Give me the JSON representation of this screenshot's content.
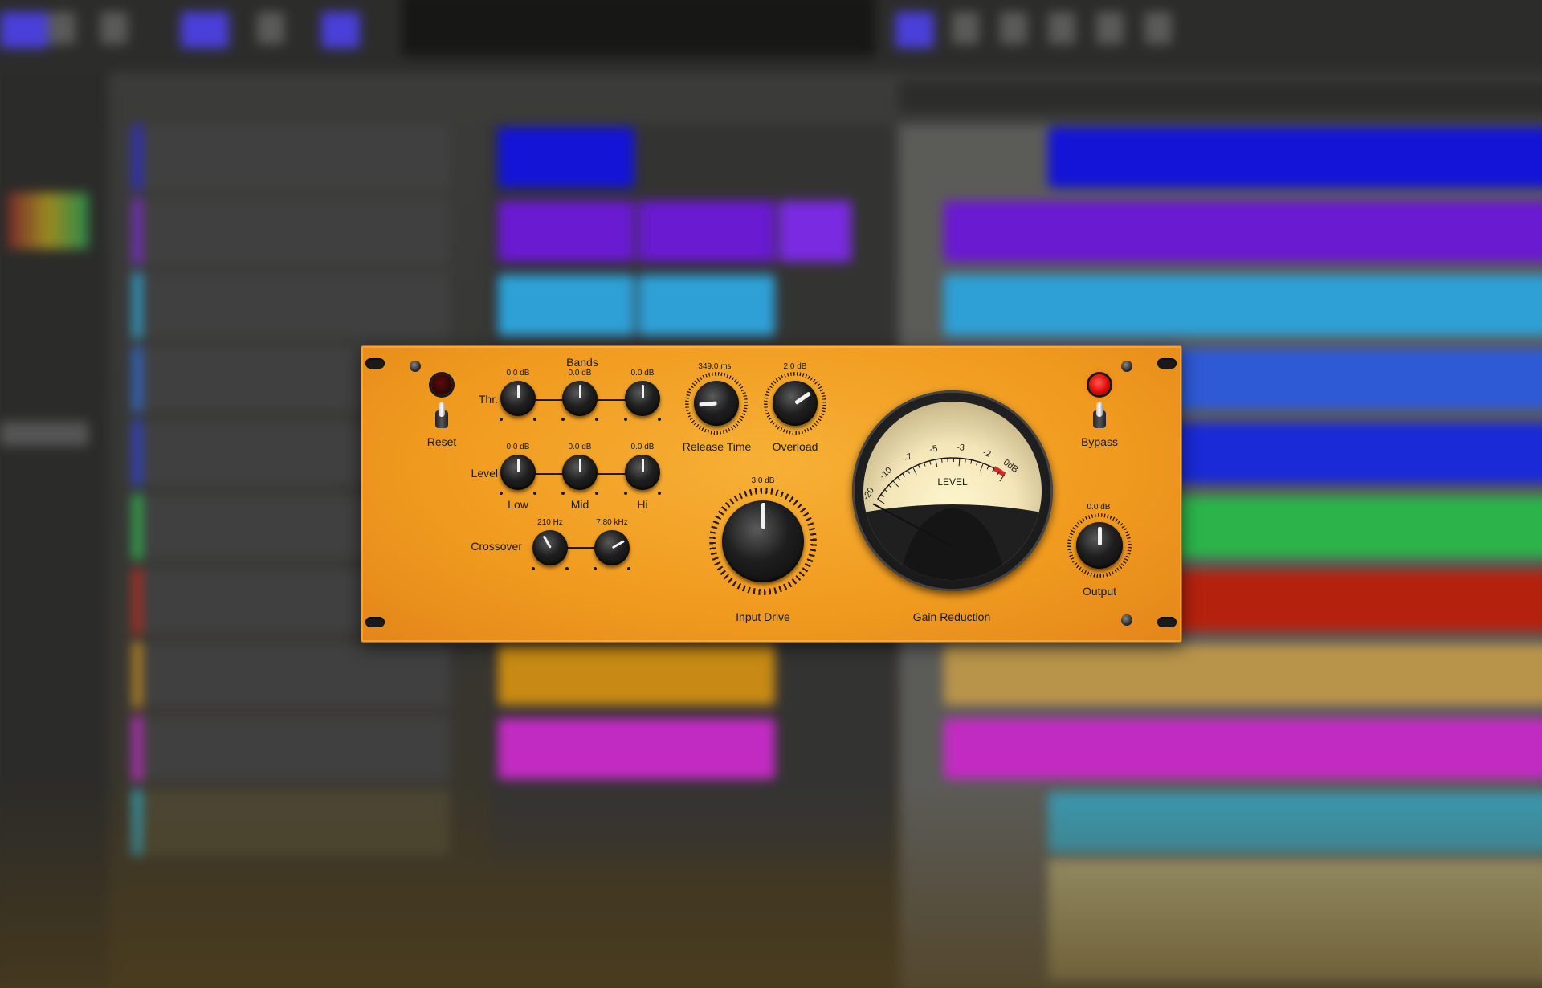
{
  "plugin": {
    "reset_label": "Reset",
    "bypass_label": "Bypass",
    "bands_label": "Bands",
    "thr_label": "Thr.",
    "level_label": "Level",
    "crossover_label": "Crossover",
    "band_names": [
      "Low",
      "Mid",
      "Hi"
    ],
    "thr_values": [
      "0.0 dB",
      "0.0 dB",
      "0.0 dB"
    ],
    "level_values": [
      "0.0 dB",
      "0.0 dB",
      "0.0 dB"
    ],
    "crossover_values": [
      "210 Hz",
      "7.80 kHz"
    ],
    "release_time": {
      "label": "Release Time",
      "value": "349.0 ms"
    },
    "overload": {
      "label": "Overload",
      "value": "2.0 dB"
    },
    "input_drive": {
      "label": "Input Drive",
      "value": "3.0 dB"
    },
    "output": {
      "label": "Output",
      "value": "0.0 dB"
    },
    "gain_reduction_label": "Gain Reduction",
    "meter": {
      "face_label": "LEVEL",
      "scale_labels": [
        "-20",
        "-10",
        "-7",
        "-5",
        "-3",
        "-2",
        "0dB"
      ],
      "needle_value_db": -20
    },
    "bypass_led_on": true,
    "reset_led_on": false,
    "colors": {
      "panel": "#f09a1f",
      "led_on": "#e00a0a",
      "meter_face": "#f3e6b8",
      "meter_red_zone": "#d8282a"
    }
  }
}
